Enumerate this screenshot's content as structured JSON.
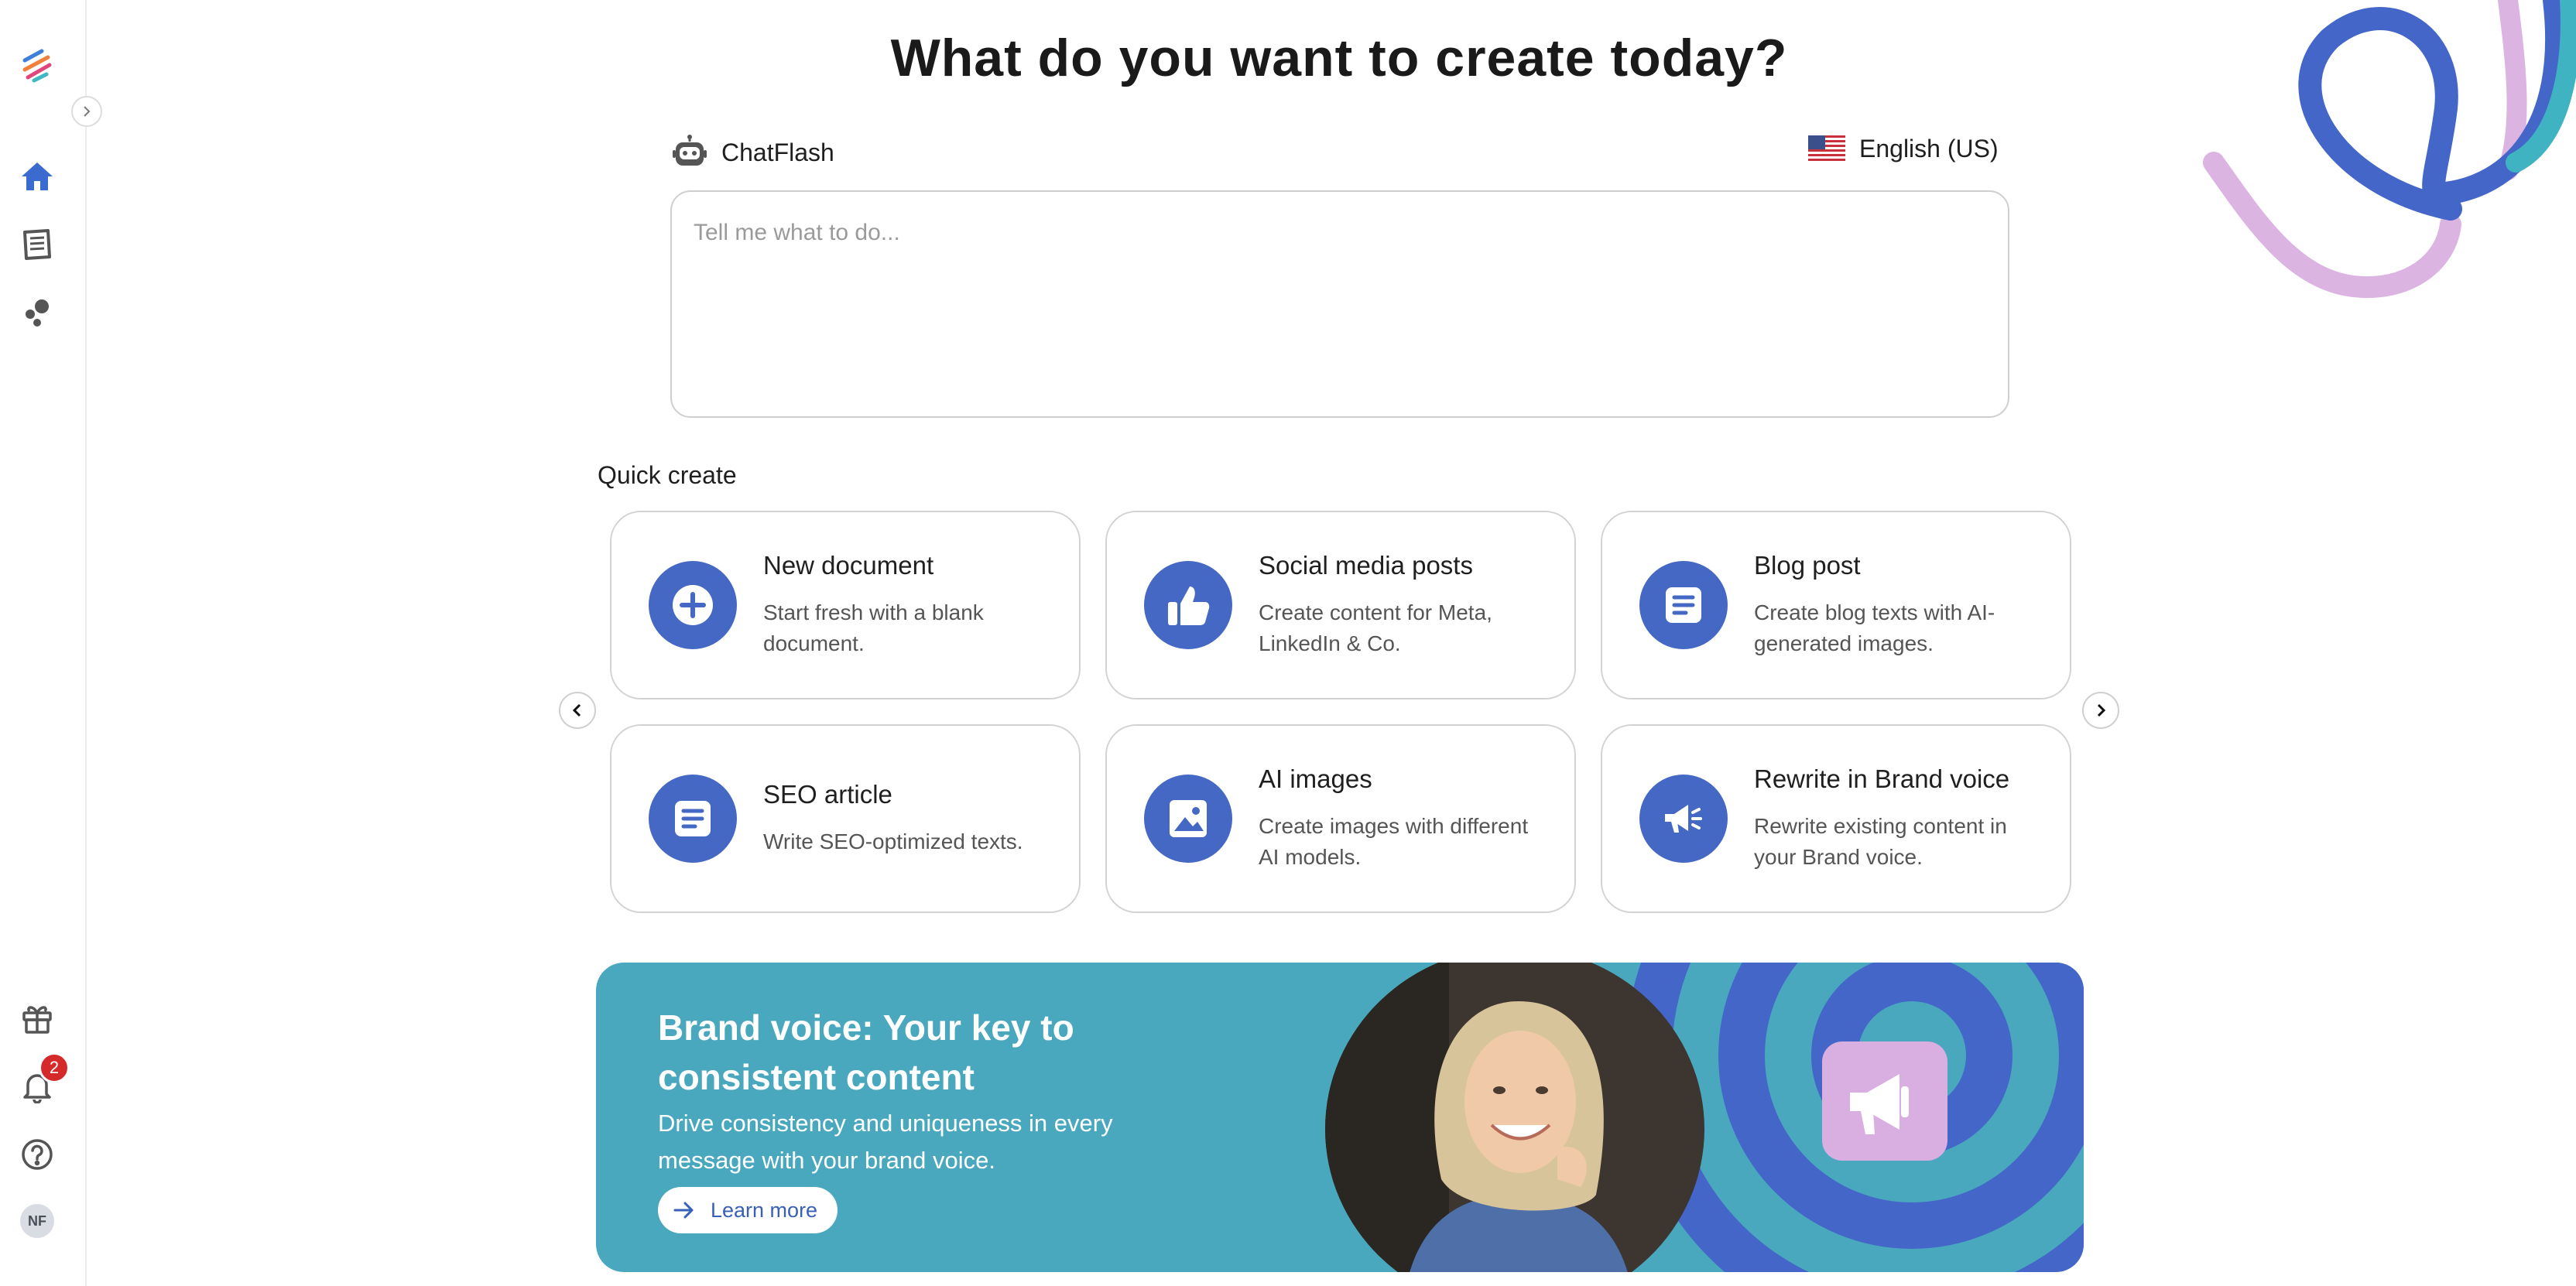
{
  "page": {
    "title": "What do you want to create today?"
  },
  "assistant": {
    "name": "ChatFlash",
    "language": "English (US)",
    "prompt_placeholder": "Tell me what to do..."
  },
  "quick_create": {
    "label": "Quick create",
    "cards": [
      {
        "title": "New document",
        "desc": "Start fresh with a blank document.",
        "icon": "plus-circle-icon"
      },
      {
        "title": "Social media posts",
        "desc": "Create content for Meta, LinkedIn & Co.",
        "icon": "thumbs-up-icon"
      },
      {
        "title": "Blog post",
        "desc": "Create blog texts with AI-generated images.",
        "icon": "document-icon"
      },
      {
        "title": "SEO article",
        "desc": "Write SEO-optimized texts.",
        "icon": "document-icon"
      },
      {
        "title": "AI images",
        "desc": "Create images with different AI models.",
        "icon": "image-icon"
      },
      {
        "title": "Rewrite in Brand voice",
        "desc": "Rewrite existing content in your Brand voice.",
        "icon": "megaphone-icon"
      }
    ]
  },
  "banner": {
    "title": "Brand voice: Your key to consistent content",
    "description": "Drive consistency and uniqueness in every message with your brand voice.",
    "button": "Learn more"
  },
  "sidebar": {
    "notification_count": "2",
    "avatar_initials": "NF",
    "items": [
      "home-icon",
      "documents-icon",
      "workflows-icon",
      "gift-icon",
      "bell-icon",
      "help-icon"
    ]
  },
  "colors": {
    "accent": "#4668c5",
    "banner": "#4aa8be",
    "badge": "#d42a2a"
  }
}
